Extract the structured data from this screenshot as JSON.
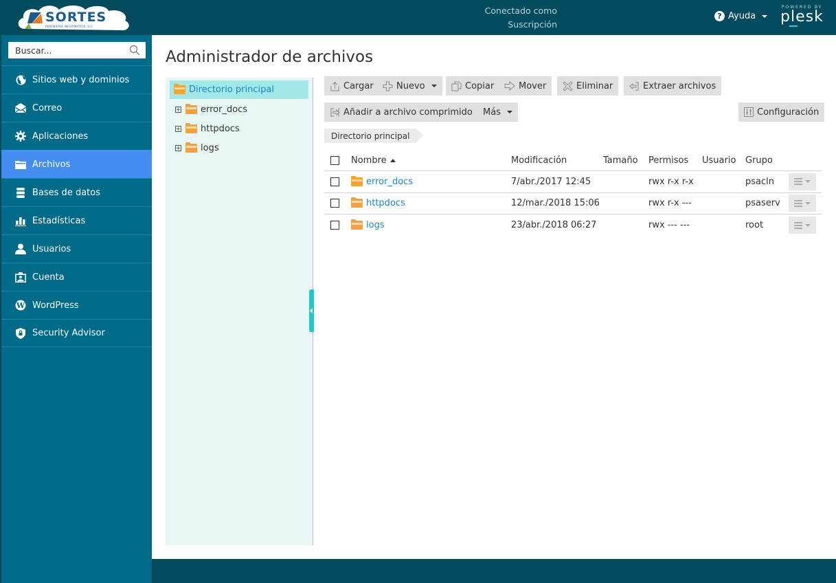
{
  "header": {
    "logo": {
      "name": "SORTES",
      "tagline": "INGENIERIA INFORMATICA, S.L."
    },
    "connected_as_label": "Conectado como",
    "subscription_label": "Suscripción",
    "help_label": "Ayuda",
    "powered_by": "POWERED BY",
    "plesk": "plesk"
  },
  "sidebar": {
    "search_placeholder": "Buscar...",
    "items": [
      {
        "label": "Sitios web y dominios",
        "icon": "globe-icon",
        "active": false
      },
      {
        "label": "Correo",
        "icon": "mail-icon",
        "active": false
      },
      {
        "label": "Aplicaciones",
        "icon": "gear-icon",
        "active": false
      },
      {
        "label": "Archivos",
        "icon": "folder-icon",
        "active": true
      },
      {
        "label": "Bases de datos",
        "icon": "database-icon",
        "active": false
      },
      {
        "label": "Estadísticas",
        "icon": "bar-chart-icon",
        "active": false
      },
      {
        "label": "Usuarios",
        "icon": "user-icon",
        "active": false
      },
      {
        "label": "Cuenta",
        "icon": "account-card-icon",
        "active": false
      },
      {
        "label": "WordPress",
        "icon": "wordpress-icon",
        "active": false
      },
      {
        "label": "Security Advisor",
        "icon": "shield-lock-icon",
        "active": false
      }
    ]
  },
  "page": {
    "title": "Administrador de archivos"
  },
  "tree": {
    "root": "Directorio principal",
    "nodes": [
      "error_docs",
      "httpdocs",
      "logs"
    ]
  },
  "toolbar": {
    "upload": "Cargar",
    "new": "Nuevo",
    "copy": "Copiar",
    "move": "Mover",
    "delete": "Eliminar",
    "extract": "Extraer archivos",
    "add_archive": "Añadir a archivo comprimido",
    "more": "Más",
    "settings": "Configuración"
  },
  "breadcrumb": "Directorio principal",
  "table": {
    "columns": {
      "name": "Nombre",
      "modified": "Modificación",
      "size": "Tamaño",
      "permissions": "Permisos",
      "user": "Usuario",
      "group": "Grupo"
    },
    "sort": {
      "column": "name",
      "direction": "asc"
    },
    "rows": [
      {
        "name": "error_docs",
        "modified": "7/abr./2017 12:45",
        "size": "",
        "permissions": "rwx r-x r-x",
        "user": "",
        "group": "psacln"
      },
      {
        "name": "httpdocs",
        "modified": "12/mar./2018 15:06",
        "size": "",
        "permissions": "rwx r-x ---",
        "user": "",
        "group": "psaserv"
      },
      {
        "name": "logs",
        "modified": "23/abr./2018 06:27",
        "size": "",
        "permissions": "rwx --- ---",
        "user": "",
        "group": "root"
      }
    ]
  },
  "colors": {
    "header_bg": "#024a5e",
    "sidebar_bg": "#006b89",
    "active_nav": "#438ef0",
    "tree_bg": "#e8f6f6",
    "tree_selected": "#a2e8e8",
    "link": "#1a87c8",
    "folder": "#f7a334"
  }
}
